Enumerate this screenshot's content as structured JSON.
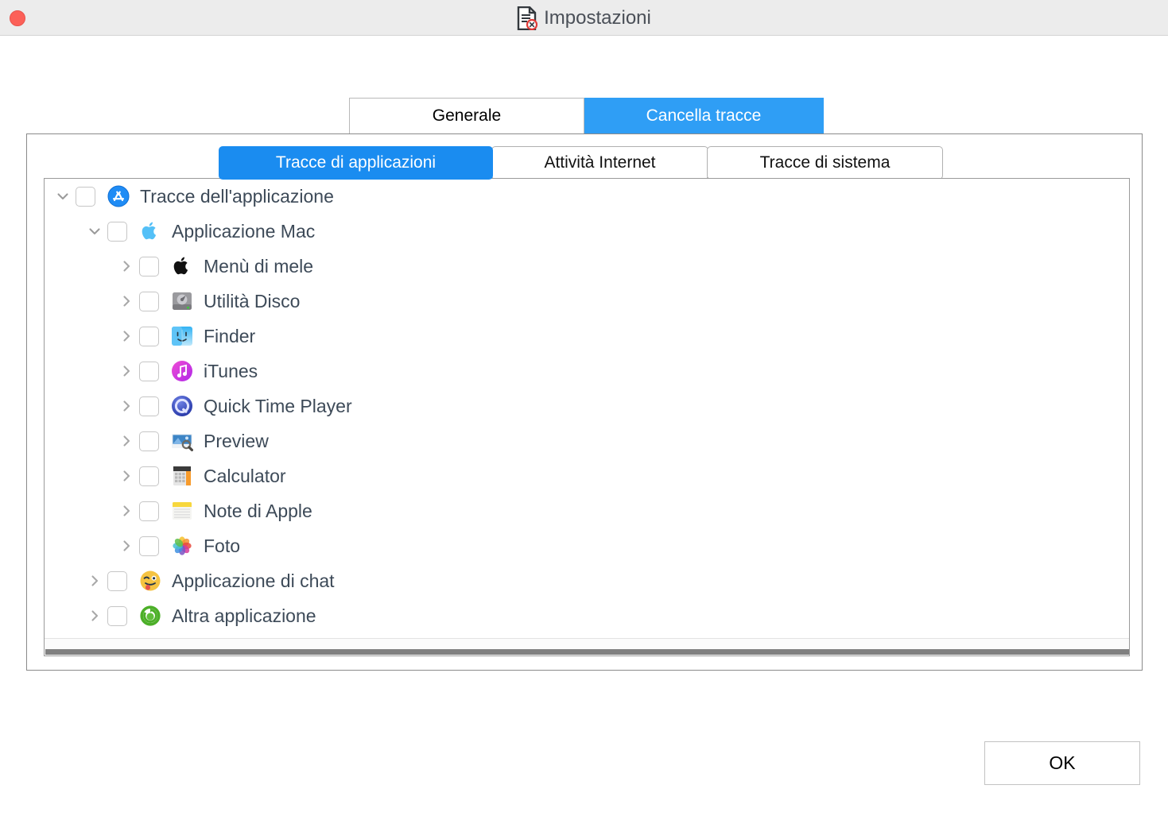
{
  "window": {
    "title": "Impostazioni",
    "title_icon": "document-erase-icon",
    "close_button": "close-window-button",
    "titlebar_color": "#ececec",
    "accent_color": "#2f9ef5"
  },
  "top_tabs": [
    {
      "label": "Generale",
      "icon": "tab-icon",
      "active": false
    },
    {
      "label": "Cancella tracce",
      "icon": "tab-icon",
      "active": true
    }
  ],
  "inner_tabs": [
    {
      "label": "Tracce di applicazioni",
      "active": true
    },
    {
      "label": "Attività Internet",
      "active": false
    },
    {
      "label": "Tracce di sistema",
      "active": false
    }
  ],
  "tree": {
    "rows": [
      {
        "level": 0,
        "label": "Tracce dell'applicazione",
        "icon": "app-store-icon",
        "twisty": "chevron-down",
        "checked": false
      },
      {
        "level": 1,
        "label": "Applicazione Mac",
        "icon": "apple-light-icon",
        "twisty": "chevron-down",
        "checked": false
      },
      {
        "level": 2,
        "label": "Menù di mele",
        "icon": "apple-black-icon",
        "twisty": "chevron-right",
        "checked": false
      },
      {
        "level": 2,
        "label": "Utilità Disco",
        "icon": "disk-utility-icon",
        "twisty": "chevron-right",
        "checked": false
      },
      {
        "level": 2,
        "label": "Finder",
        "icon": "finder-icon",
        "twisty": "chevron-right",
        "checked": false
      },
      {
        "level": 2,
        "label": "iTunes",
        "icon": "itunes-icon",
        "twisty": "chevron-right",
        "checked": false
      },
      {
        "level": 2,
        "label": "Quick Time Player",
        "icon": "quicktime-icon",
        "twisty": "chevron-right",
        "checked": false
      },
      {
        "level": 2,
        "label": "Preview",
        "icon": "preview-icon",
        "twisty": "chevron-right",
        "checked": false
      },
      {
        "level": 2,
        "label": "Calculator",
        "icon": "calculator-icon",
        "twisty": "chevron-right",
        "checked": false
      },
      {
        "level": 2,
        "label": "Note di Apple",
        "icon": "notes-icon",
        "twisty": "chevron-right",
        "checked": false
      },
      {
        "level": 2,
        "label": "Foto",
        "icon": "photos-icon",
        "twisty": "chevron-right",
        "checked": false
      },
      {
        "level": 1,
        "label": "Applicazione di chat",
        "icon": "chat-emoji-icon",
        "twisty": "chevron-right",
        "checked": false
      },
      {
        "level": 1,
        "label": "Altra applicazione",
        "icon": "other-app-green-icon",
        "twisty": "chevron-right",
        "checked": false
      }
    ]
  },
  "scrollbar": {
    "orientation": "horizontal",
    "thumb_color": "#808080"
  },
  "footer": {
    "ok_label": "OK"
  }
}
